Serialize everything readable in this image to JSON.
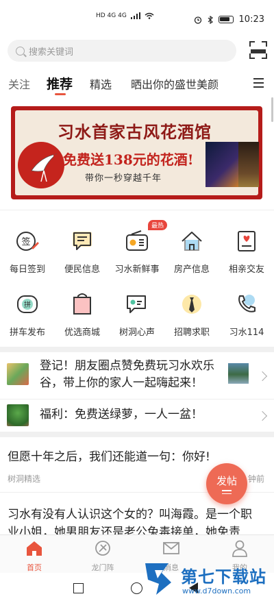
{
  "status_bar": {
    "left_indicators": "HD 4G 4G",
    "time": "10:23"
  },
  "search": {
    "placeholder": "搜索关键词"
  },
  "tabs": [
    {
      "label": "关注"
    },
    {
      "label": "推荐"
    },
    {
      "label": "精选"
    },
    {
      "label": "晒出你的盛世美颜"
    }
  ],
  "banner": {
    "line1": "习水首家古风花酒馆",
    "line2": "免费送138元的花酒!",
    "line3": "带你一秒穿越千年"
  },
  "grid": [
    {
      "label": "每日签到",
      "icon": "sign-in-icon",
      "glyph": "签"
    },
    {
      "label": "便民信息",
      "icon": "message-icon"
    },
    {
      "label": "习水新鲜事",
      "icon": "radio-icon"
    },
    {
      "label": "房产信息",
      "icon": "house-icon"
    },
    {
      "label": "相亲交友",
      "icon": "heart-card-icon"
    },
    {
      "label": "拼车发布",
      "icon": "car-icon",
      "glyph": "拼"
    },
    {
      "label": "优选商城",
      "icon": "shopping-bag-icon"
    },
    {
      "label": "树洞心声",
      "icon": "chat-bubble-icon"
    },
    {
      "label": "招聘求职",
      "icon": "tie-icon"
    },
    {
      "label": "习水114",
      "icon": "phone-icon"
    }
  ],
  "hot_badge": "最热",
  "news": [
    {
      "text_line1": "登记！朋友圈点赞免费玩习水欢乐",
      "text_line2": "谷，带上你的家人一起嗨起来！"
    },
    {
      "text_line1": "福利：免费送绿萝，一人一盆！"
    }
  ],
  "posts": [
    {
      "title": "但愿十年之后，我们还能道一句：你好!",
      "source": "树洞精选",
      "time": "钟前"
    },
    {
      "title_line1": "习水有没有人认识这个女的？叫海霞。是一个职",
      "title_line2": "业小姐，她男朋友还是老公兔毒接单，她免责"
    }
  ],
  "fab": {
    "label": "发帖"
  },
  "bottom_nav": [
    {
      "label": "首页",
      "icon": "home-icon",
      "active": true
    },
    {
      "label": "龙门阵",
      "icon": "compass-icon",
      "active": false
    },
    {
      "label": "消息",
      "icon": "mail-icon",
      "active": false
    },
    {
      "label": "我的",
      "icon": "user-icon",
      "active": false
    }
  ],
  "watermark": {
    "name": "第七下载站",
    "url": "www.d7down.com"
  },
  "colors": {
    "accent": "#e8553e",
    "banner_red": "#b51c1a",
    "watermark_blue": "#1d6fc0"
  }
}
